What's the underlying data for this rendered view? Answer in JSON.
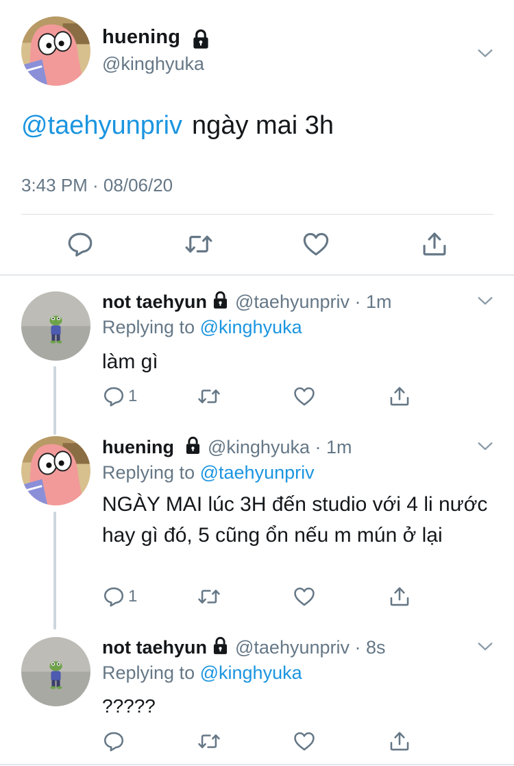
{
  "main_tweet": {
    "author_name": "huening",
    "author_handle": "@kinghyuka",
    "mention": "@taehyunpriv",
    "text": "ngày mai 3h",
    "timestamp": "3:43 PM · 08/06/20",
    "icons": [
      "lock-icon",
      "chevron-down-icon",
      "reply-icon",
      "retweet-icon",
      "like-icon",
      "share-icon"
    ]
  },
  "replies": [
    {
      "author_name": "not taehyun",
      "author_handle": "@taehyunpriv",
      "time": "· 1m",
      "replying_prefix": "Replying to",
      "replying_to": "@kinghyuka",
      "text": "làm gì",
      "reply_count": "1"
    },
    {
      "author_name": "huening",
      "author_handle": "@kinghyuka",
      "time": "· 1m",
      "replying_prefix": "Replying to",
      "replying_to": "@taehyunpriv",
      "text": "NGÀY MAI lúc 3H đến studio với 4 li nước hay gì đó, 5 cũng ổn nếu m mún ở lại",
      "reply_count": "1"
    },
    {
      "author_name": "not taehyun",
      "author_handle": "@taehyunpriv",
      "time": "· 8s",
      "replying_prefix": "Replying to",
      "replying_to": "@kinghyuka",
      "text": "?????",
      "reply_count": ""
    }
  ],
  "colors": {
    "link": "#1b95e0",
    "secondary_text": "#657786",
    "primary_text": "#14171a",
    "divider": "#e3e6e9",
    "thread_line": "#ccd6dd"
  }
}
